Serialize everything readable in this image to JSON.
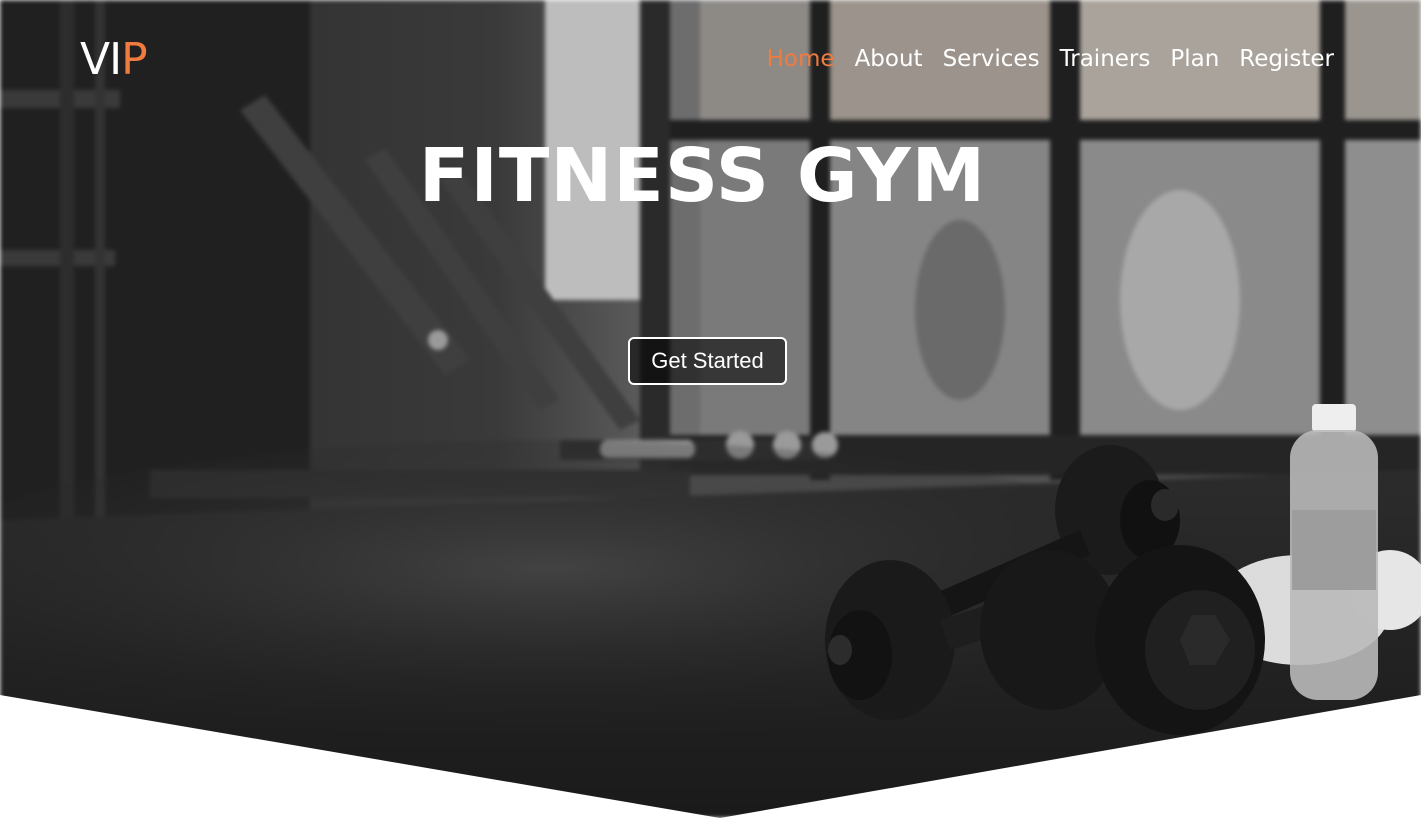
{
  "brand": {
    "logo_main": "VI",
    "logo_accent": "P",
    "accent_color": "#f07b3f"
  },
  "nav": {
    "items": [
      {
        "label": "Home",
        "active": true
      },
      {
        "label": "About",
        "active": false
      },
      {
        "label": "Services",
        "active": false
      },
      {
        "label": "Trainers",
        "active": false
      },
      {
        "label": "Plan",
        "active": false
      },
      {
        "label": "Register",
        "active": false
      }
    ]
  },
  "hero": {
    "title": "FITNESS GYM",
    "cta_label": "Get Started"
  }
}
